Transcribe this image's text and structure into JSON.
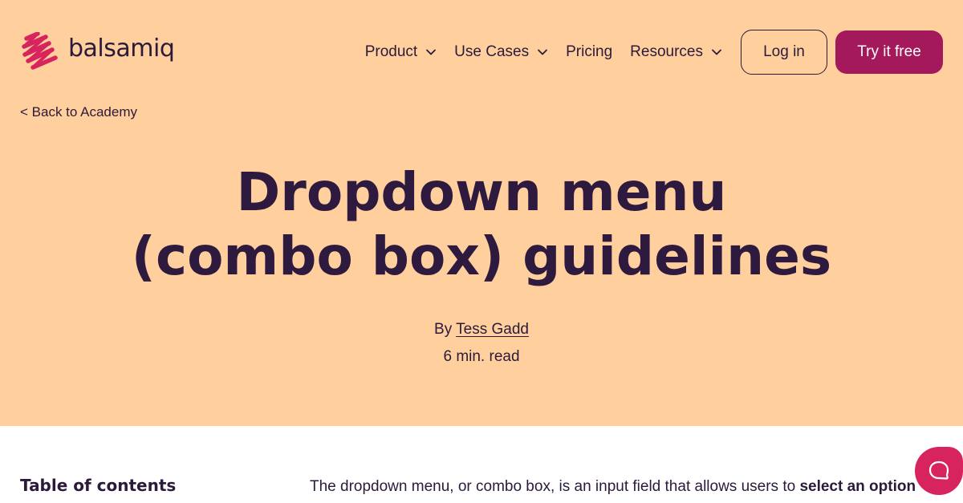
{
  "brand": {
    "name": "balsamiq",
    "accent": "#a3195b",
    "hero_bg": "#ffcf9e",
    "text": "#2b1a3a"
  },
  "nav": {
    "items": [
      {
        "label": "Product",
        "has_dropdown": true
      },
      {
        "label": "Use Cases",
        "has_dropdown": true
      },
      {
        "label": "Pricing",
        "has_dropdown": false
      },
      {
        "label": "Resources",
        "has_dropdown": true
      }
    ],
    "login_label": "Log in",
    "cta_label": "Try it free"
  },
  "back_link": "< Back to Academy",
  "article": {
    "title_line1": "Dropdown menu",
    "title_line2": "(combo box) guidelines",
    "by_prefix": "By",
    "author": "Tess Gadd",
    "read_time": "6 min. read"
  },
  "toc": {
    "title": "Table of contents"
  },
  "intro": {
    "text": "The dropdown menu, or combo box, is an input field that allows users to ",
    "bold": "select an option"
  },
  "chat": {
    "icon": "chat-bubble-icon",
    "color": "#d8245e"
  }
}
